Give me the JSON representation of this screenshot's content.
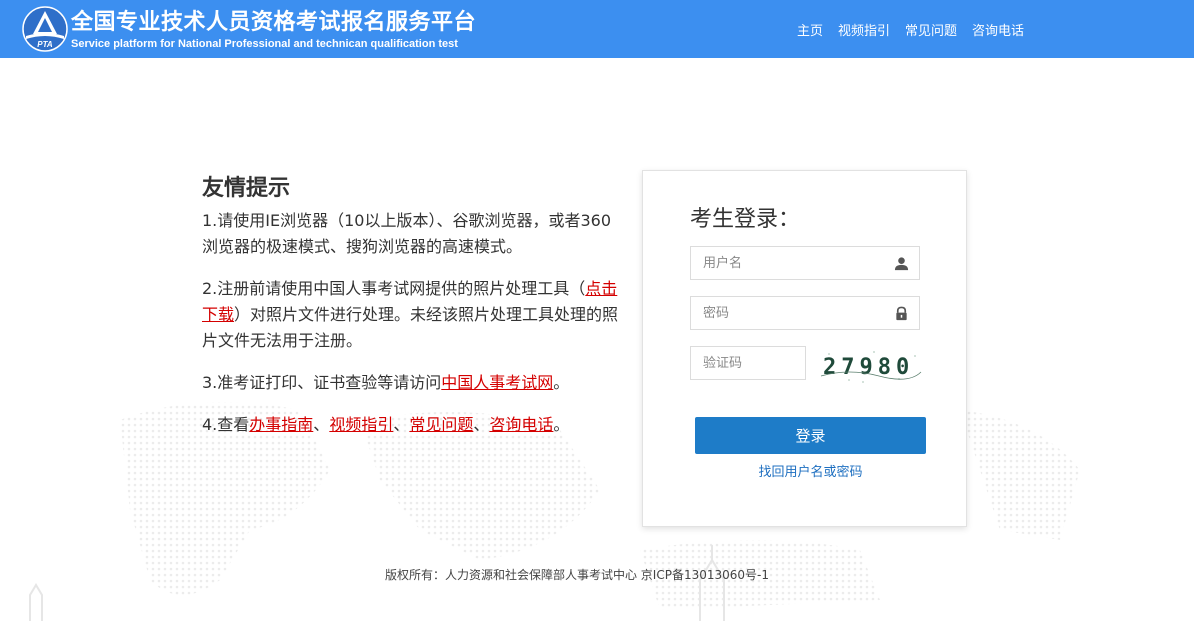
{
  "header": {
    "title_cn": "全国专业技术人员资格考试报名服务平台",
    "title_en": "Service platform for National Professional and technican qualification test",
    "logo_text": "PTA",
    "nav": [
      "主页",
      "视频指引",
      "常见问题",
      "咨询电话"
    ]
  },
  "tips": {
    "heading": "友情提示",
    "tip1": "1.请使用IE浏览器（10以上版本）、谷歌浏览器，或者360浏览器的极速模式、搜狗浏览器的高速模式。",
    "tip2_a": "2.注册前请使用中国人事考试网提供的照片处理工具（",
    "tip2_link": "点击下载",
    "tip2_b": "）对照片文件进行处理。未经该照片处理工具处理的照片文件无法用于注册。",
    "tip3_a": "3.准考证打印、证书查验等请访问",
    "tip3_link": "中国人事考试网",
    "tip3_b": "。",
    "tip4_a": "4.查看",
    "tip4_link1": "办事指南",
    "sep": "、",
    "tip4_link2": "视频指引",
    "tip4_link3": "常见问题",
    "tip4_link4": "咨询电话",
    "tip4_end": "。"
  },
  "login": {
    "title": "考生登录：",
    "username_placeholder": "用户名",
    "password_placeholder": "密码",
    "captcha_placeholder": "验证码",
    "captcha_text": "27980",
    "login_button": "登录",
    "forgot_link": "找回用户名或密码"
  },
  "footer": {
    "copyright": "版权所有：人力资源和社会保障部人事考试中心 京ICP备13013060号-1"
  },
  "colors": {
    "header_bg": "#3c8ff0",
    "button_bg": "#1e7cc8",
    "link_red": "#d40000",
    "link_blue": "#1e6fc0"
  }
}
